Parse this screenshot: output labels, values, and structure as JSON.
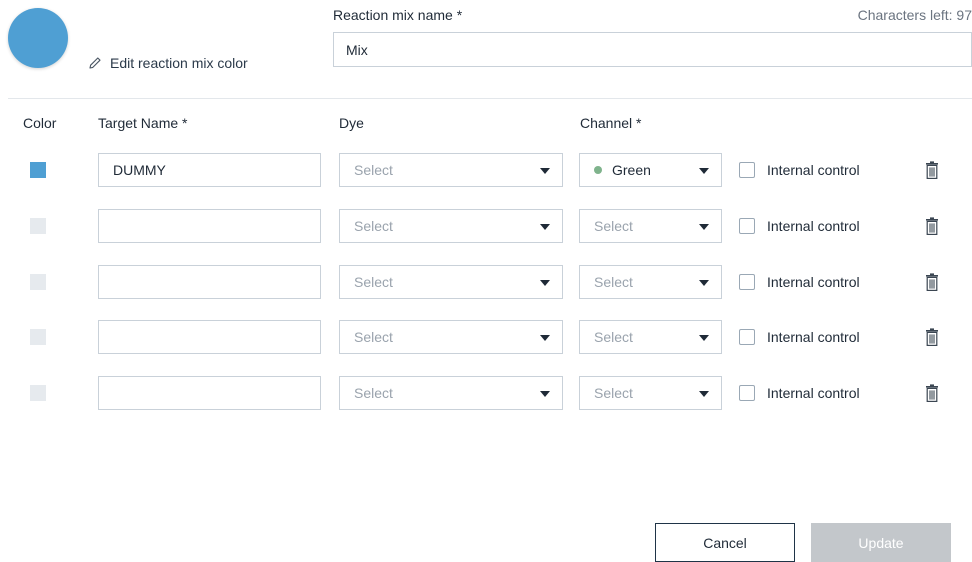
{
  "header": {
    "edit_color_label": "Edit reaction mix color",
    "mix_name_label": "Reaction mix name *",
    "chars_left": "Characters left: 97",
    "mix_name_value": "Mix",
    "mix_color": "#4f9fd3"
  },
  "columns": {
    "color": "Color",
    "target_name": "Target Name *",
    "dye": "Dye",
    "channel": "Channel *"
  },
  "rows": [
    {
      "color_set": true,
      "target_name": "DUMMY",
      "dye": "Select",
      "channel": "Green",
      "channel_set": true,
      "internal_control": "Internal control",
      "checked": false
    },
    {
      "color_set": false,
      "target_name": "",
      "dye": "Select",
      "channel": "Select",
      "channel_set": false,
      "internal_control": "Internal control",
      "checked": false
    },
    {
      "color_set": false,
      "target_name": "",
      "dye": "Select",
      "channel": "Select",
      "channel_set": false,
      "internal_control": "Internal control",
      "checked": false
    },
    {
      "color_set": false,
      "target_name": "",
      "dye": "Select",
      "channel": "Select",
      "channel_set": false,
      "internal_control": "Internal control",
      "checked": false
    },
    {
      "color_set": false,
      "target_name": "",
      "dye": "Select",
      "channel": "Select",
      "channel_set": false,
      "internal_control": "Internal control",
      "checked": false
    }
  ],
  "footer": {
    "cancel_label": "Cancel",
    "update_label": "Update"
  },
  "icons": {
    "edit": "pencil-icon",
    "delete": "trash-icon",
    "dropdown": "caret-down-icon"
  }
}
